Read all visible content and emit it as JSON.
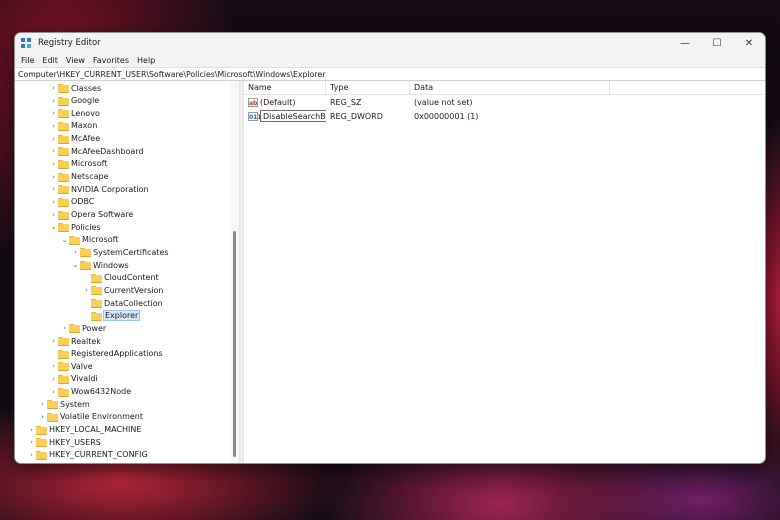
{
  "window": {
    "title": "Registry Editor",
    "controls": [
      "—",
      "☐",
      "✕"
    ]
  },
  "menu": [
    "File",
    "Edit",
    "View",
    "Favorites",
    "Help"
  ],
  "address": "Computer\\HKEY_CURRENT_USER\\Software\\Policies\\Microsoft\\Windows\\Explorer",
  "tree": [
    {
      "label": "Classes",
      "depth": 2,
      "expander": "›"
    },
    {
      "label": "Google",
      "depth": 2,
      "expander": "›"
    },
    {
      "label": "Lenovo",
      "depth": 2,
      "expander": "›"
    },
    {
      "label": "Maxon",
      "depth": 2,
      "expander": "›"
    },
    {
      "label": "McAfee",
      "depth": 2,
      "expander": "›"
    },
    {
      "label": "McAfeeDashboard",
      "depth": 2,
      "expander": "›"
    },
    {
      "label": "Microsoft",
      "depth": 2,
      "expander": "›"
    },
    {
      "label": "Netscape",
      "depth": 2,
      "expander": "›"
    },
    {
      "label": "NVIDIA Corporation",
      "depth": 2,
      "expander": "›"
    },
    {
      "label": "ODBC",
      "depth": 2,
      "expander": "›"
    },
    {
      "label": "Opera Software",
      "depth": 2,
      "expander": "›"
    },
    {
      "label": "Policies",
      "depth": 2,
      "expander": "⌄"
    },
    {
      "label": "Microsoft",
      "depth": 3,
      "expander": "⌄"
    },
    {
      "label": "SystemCertificates",
      "depth": 4,
      "expander": "›"
    },
    {
      "label": "Windows",
      "depth": 4,
      "expander": "⌄"
    },
    {
      "label": "CloudContent",
      "depth": 5,
      "expander": ""
    },
    {
      "label": "CurrentVersion",
      "depth": 5,
      "expander": "›"
    },
    {
      "label": "DataCollection",
      "depth": 5,
      "expander": ""
    },
    {
      "label": "Explorer",
      "depth": 5,
      "expander": "",
      "selected": true
    },
    {
      "label": "Power",
      "depth": 3,
      "expander": "›"
    },
    {
      "label": "Realtek",
      "depth": 2,
      "expander": "›"
    },
    {
      "label": "RegisteredApplications",
      "depth": 2,
      "expander": ""
    },
    {
      "label": "Valve",
      "depth": 2,
      "expander": "›"
    },
    {
      "label": "Vivaldi",
      "depth": 2,
      "expander": "›"
    },
    {
      "label": "Wow6432Node",
      "depth": 2,
      "expander": "›"
    },
    {
      "label": "System",
      "depth": 1,
      "expander": "›"
    },
    {
      "label": "Volatile Environment",
      "depth": 1,
      "expander": "›"
    },
    {
      "label": "HKEY_LOCAL_MACHINE",
      "depth": 0,
      "expander": "›"
    },
    {
      "label": "HKEY_USERS",
      "depth": 0,
      "expander": "›"
    },
    {
      "label": "HKEY_CURRENT_CONFIG",
      "depth": 0,
      "expander": "›"
    }
  ],
  "list": {
    "columns": [
      "Name",
      "Type",
      "Data"
    ],
    "rows": [
      {
        "icon": "reg-sz-icon",
        "icon_text": "ab",
        "name": "(Default)",
        "type": "REG_SZ",
        "data": "(value not set)",
        "editing": false
      },
      {
        "icon": "reg-dword-icon",
        "icon_text": "011",
        "name": "DisableSearchBo...",
        "type": "REG_DWORD",
        "data": "0x00000001 (1)",
        "editing": true
      }
    ]
  }
}
